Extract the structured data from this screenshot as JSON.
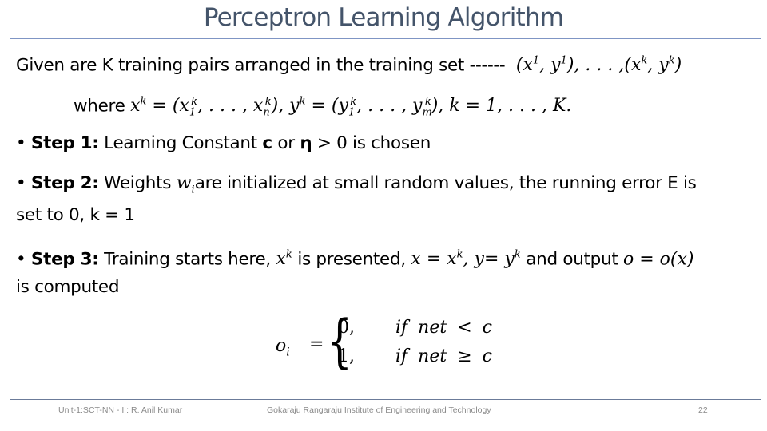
{
  "slide": {
    "title": "Perceptron Learning Algorithm",
    "intro": {
      "text": "Given are K training pairs arranged in the training set ------",
      "pairs_math": "(x¹, y¹), . . . ,(xᵏ, yᵏ)",
      "where_label": "where",
      "where_math": "xᵏ = (x₁ᵏ, . . . , xₙᵏ), yᵏ = (y₁ᵏ, . . . , yₘᵏ), k = 1, . . . , K."
    },
    "steps": [
      {
        "label": "Step 1:",
        "text_parts": [
          "Learning Constant ",
          "c",
          " or ",
          "η",
          " > 0 is chosen"
        ]
      },
      {
        "label": "Step 2:",
        "text_before": "Weights ",
        "math": "wᵢ",
        "text_after": "are initialized at small random values, the running error E is",
        "continuation": "set to 0, k = 1"
      },
      {
        "label": "Step 3:",
        "text_before": "Training starts here, ",
        "math1": "xᵏ",
        "text_mid1": " is presented, ",
        "math2": "x = xᵏ, y = yᵏ",
        "text_mid2": " and output ",
        "math3": "o = o(x)",
        "continuation": "is computed"
      }
    ],
    "equation": {
      "lhs": "o",
      "lhs_sub": "i",
      "eq": "=",
      "cases": [
        {
          "value": "0,",
          "condition": "if net < c"
        },
        {
          "value": "1,",
          "condition": "if net ≥ c"
        }
      ]
    }
  },
  "footer": {
    "left": "Unit-1:SCT-NN - I : R. Anil Kumar",
    "center": "Gokaraju Rangaraju Institute of Engineering and Technology",
    "page_number": "22"
  },
  "colors": {
    "title": "#44546a",
    "border": "#6b7b99",
    "footer_text": "#8a8a8a"
  }
}
